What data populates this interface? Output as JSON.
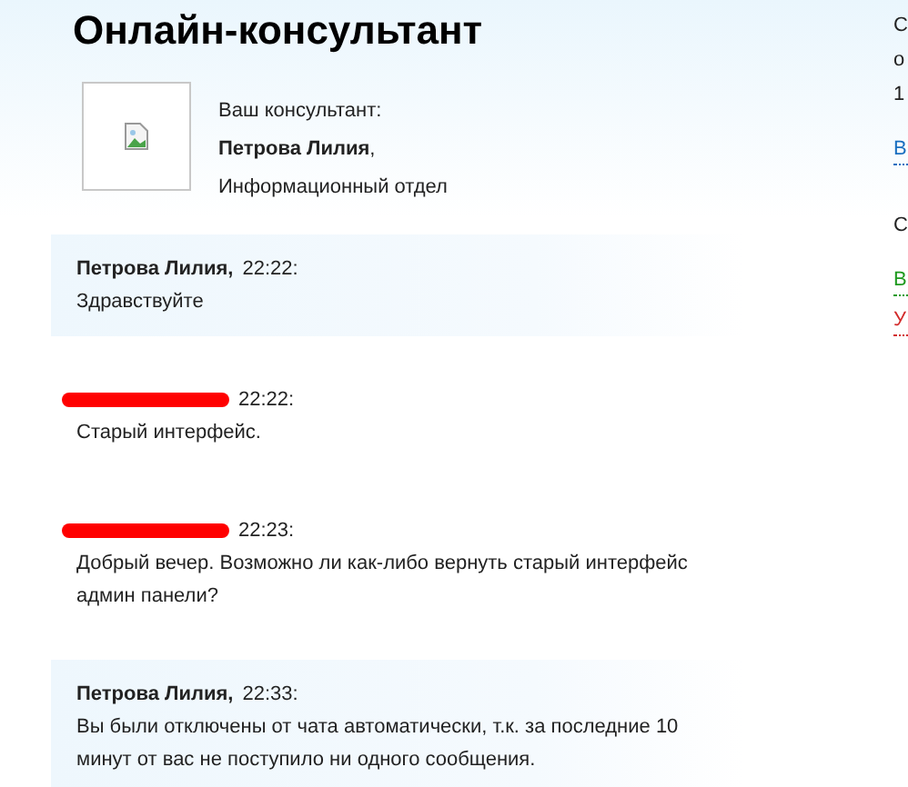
{
  "title": "Онлайн-консультант",
  "consultant": {
    "caption": "Ваш консультант:",
    "name": "Петрова Лилия",
    "name_suffix": ",",
    "department": "Информационный отдел"
  },
  "messages": [
    {
      "kind": "consultant",
      "author": "Петрова Лилия,",
      "time": "22:22:",
      "text": "Здравствуйте"
    },
    {
      "kind": "visitor",
      "redacted": true,
      "time": "22:22:",
      "text": "Старый интерфейс."
    },
    {
      "kind": "visitor",
      "redacted": true,
      "time": "22:23:",
      "text": "Добрый вечер. Возможно ли как-либо вернуть старый интерфейс админ панели?"
    },
    {
      "kind": "consultant",
      "author": "Петрова Лилия,",
      "time": "22:33:",
      "text": "Вы были отключены от чата автоматически, т.к. за последние 10 минут от вас не поступило ни одного сообщения."
    }
  ],
  "side_panel": [
    {
      "kind": "text",
      "text": "С"
    },
    {
      "kind": "text",
      "text": "о"
    },
    {
      "kind": "text",
      "text": "1"
    },
    {
      "kind": "link",
      "text": "В",
      "color": "#1a6fc0"
    },
    {
      "kind": "gap"
    },
    {
      "kind": "text",
      "text": "С"
    },
    {
      "kind": "link",
      "text": "В",
      "color": "#1f9a1f"
    },
    {
      "kind": "link",
      "text": "У",
      "color": "#d22a2a"
    }
  ]
}
